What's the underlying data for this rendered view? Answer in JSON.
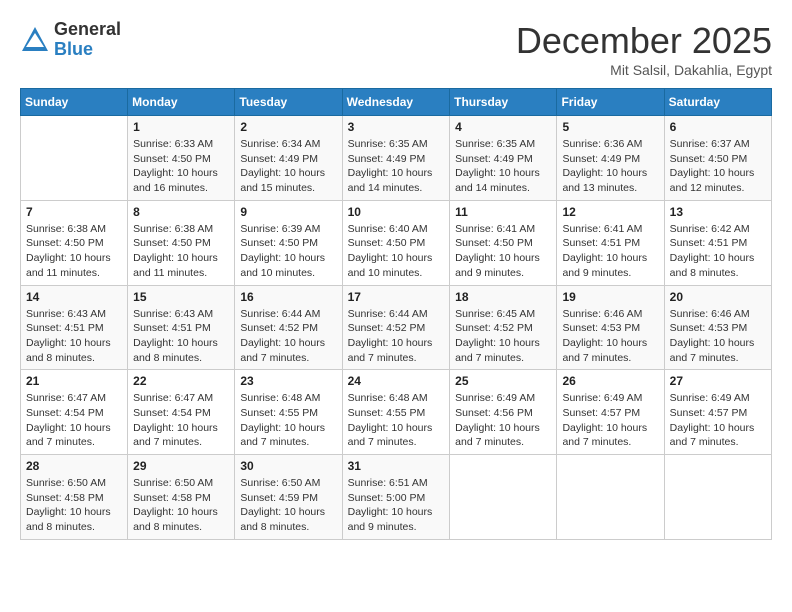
{
  "logo": {
    "general": "General",
    "blue": "Blue"
  },
  "header": {
    "month": "December 2025",
    "location": "Mit Salsil, Dakahlia, Egypt"
  },
  "weekdays": [
    "Sunday",
    "Monday",
    "Tuesday",
    "Wednesday",
    "Thursday",
    "Friday",
    "Saturday"
  ],
  "weeks": [
    [
      {
        "day": "",
        "info": ""
      },
      {
        "day": "1",
        "info": "Sunrise: 6:33 AM\nSunset: 4:50 PM\nDaylight: 10 hours\nand 16 minutes."
      },
      {
        "day": "2",
        "info": "Sunrise: 6:34 AM\nSunset: 4:49 PM\nDaylight: 10 hours\nand 15 minutes."
      },
      {
        "day": "3",
        "info": "Sunrise: 6:35 AM\nSunset: 4:49 PM\nDaylight: 10 hours\nand 14 minutes."
      },
      {
        "day": "4",
        "info": "Sunrise: 6:35 AM\nSunset: 4:49 PM\nDaylight: 10 hours\nand 14 minutes."
      },
      {
        "day": "5",
        "info": "Sunrise: 6:36 AM\nSunset: 4:49 PM\nDaylight: 10 hours\nand 13 minutes."
      },
      {
        "day": "6",
        "info": "Sunrise: 6:37 AM\nSunset: 4:50 PM\nDaylight: 10 hours\nand 12 minutes."
      }
    ],
    [
      {
        "day": "7",
        "info": "Sunrise: 6:38 AM\nSunset: 4:50 PM\nDaylight: 10 hours\nand 11 minutes."
      },
      {
        "day": "8",
        "info": "Sunrise: 6:38 AM\nSunset: 4:50 PM\nDaylight: 10 hours\nand 11 minutes."
      },
      {
        "day": "9",
        "info": "Sunrise: 6:39 AM\nSunset: 4:50 PM\nDaylight: 10 hours\nand 10 minutes."
      },
      {
        "day": "10",
        "info": "Sunrise: 6:40 AM\nSunset: 4:50 PM\nDaylight: 10 hours\nand 10 minutes."
      },
      {
        "day": "11",
        "info": "Sunrise: 6:41 AM\nSunset: 4:50 PM\nDaylight: 10 hours\nand 9 minutes."
      },
      {
        "day": "12",
        "info": "Sunrise: 6:41 AM\nSunset: 4:51 PM\nDaylight: 10 hours\nand 9 minutes."
      },
      {
        "day": "13",
        "info": "Sunrise: 6:42 AM\nSunset: 4:51 PM\nDaylight: 10 hours\nand 8 minutes."
      }
    ],
    [
      {
        "day": "14",
        "info": "Sunrise: 6:43 AM\nSunset: 4:51 PM\nDaylight: 10 hours\nand 8 minutes."
      },
      {
        "day": "15",
        "info": "Sunrise: 6:43 AM\nSunset: 4:51 PM\nDaylight: 10 hours\nand 8 minutes."
      },
      {
        "day": "16",
        "info": "Sunrise: 6:44 AM\nSunset: 4:52 PM\nDaylight: 10 hours\nand 7 minutes."
      },
      {
        "day": "17",
        "info": "Sunrise: 6:44 AM\nSunset: 4:52 PM\nDaylight: 10 hours\nand 7 minutes."
      },
      {
        "day": "18",
        "info": "Sunrise: 6:45 AM\nSunset: 4:52 PM\nDaylight: 10 hours\nand 7 minutes."
      },
      {
        "day": "19",
        "info": "Sunrise: 6:46 AM\nSunset: 4:53 PM\nDaylight: 10 hours\nand 7 minutes."
      },
      {
        "day": "20",
        "info": "Sunrise: 6:46 AM\nSunset: 4:53 PM\nDaylight: 10 hours\nand 7 minutes."
      }
    ],
    [
      {
        "day": "21",
        "info": "Sunrise: 6:47 AM\nSunset: 4:54 PM\nDaylight: 10 hours\nand 7 minutes."
      },
      {
        "day": "22",
        "info": "Sunrise: 6:47 AM\nSunset: 4:54 PM\nDaylight: 10 hours\nand 7 minutes."
      },
      {
        "day": "23",
        "info": "Sunrise: 6:48 AM\nSunset: 4:55 PM\nDaylight: 10 hours\nand 7 minutes."
      },
      {
        "day": "24",
        "info": "Sunrise: 6:48 AM\nSunset: 4:55 PM\nDaylight: 10 hours\nand 7 minutes."
      },
      {
        "day": "25",
        "info": "Sunrise: 6:49 AM\nSunset: 4:56 PM\nDaylight: 10 hours\nand 7 minutes."
      },
      {
        "day": "26",
        "info": "Sunrise: 6:49 AM\nSunset: 4:57 PM\nDaylight: 10 hours\nand 7 minutes."
      },
      {
        "day": "27",
        "info": "Sunrise: 6:49 AM\nSunset: 4:57 PM\nDaylight: 10 hours\nand 7 minutes."
      }
    ],
    [
      {
        "day": "28",
        "info": "Sunrise: 6:50 AM\nSunset: 4:58 PM\nDaylight: 10 hours\nand 8 minutes."
      },
      {
        "day": "29",
        "info": "Sunrise: 6:50 AM\nSunset: 4:58 PM\nDaylight: 10 hours\nand 8 minutes."
      },
      {
        "day": "30",
        "info": "Sunrise: 6:50 AM\nSunset: 4:59 PM\nDaylight: 10 hours\nand 8 minutes."
      },
      {
        "day": "31",
        "info": "Sunrise: 6:51 AM\nSunset: 5:00 PM\nDaylight: 10 hours\nand 9 minutes."
      },
      {
        "day": "",
        "info": ""
      },
      {
        "day": "",
        "info": ""
      },
      {
        "day": "",
        "info": ""
      }
    ]
  ]
}
